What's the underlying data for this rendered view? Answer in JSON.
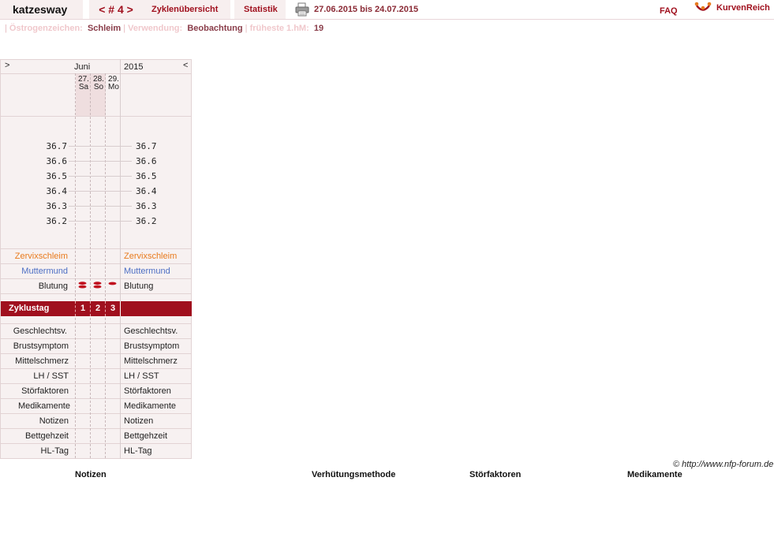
{
  "header": {
    "user": "katzesway",
    "cycle_nav": "< # 4 >",
    "tab_overview": "Zyklenübersicht",
    "tab_stats": "Statistik",
    "date_range": "27.06.2015 bis 24.07.2015",
    "faq": "FAQ",
    "brand": "KurvenReich"
  },
  "info": {
    "sep": "|",
    "estrogen_label": "Östrogenzeichen:",
    "estrogen_value": "Schleim",
    "use_label": "Verwendung:",
    "use_value": "Beobachtung",
    "earliest_label": "früheste 1.hM:",
    "earliest_value": "19"
  },
  "chart": {
    "nav_prev": ">",
    "nav_next": "<",
    "month": "Juni",
    "year": "2015",
    "days": [
      {
        "date": "27.",
        "weekday": "Sa"
      },
      {
        "date": "28.",
        "weekday": "So"
      },
      {
        "date": "29.",
        "weekday": "Mo"
      }
    ],
    "temperatures": [
      "36.7",
      "36.6",
      "36.5",
      "36.4",
      "36.3",
      "36.2"
    ],
    "rows_top": {
      "cervix": "Zervixschleim",
      "muttermund": "Muttermund",
      "blutung": "Blutung"
    },
    "bleeding": [
      2,
      2,
      1
    ],
    "zyklustag_label": "Zyklustag",
    "cycle_days": [
      "1",
      "2",
      "3"
    ],
    "rows_bottom": [
      "Geschlechtsv.",
      "Brustsymptom",
      "Mittelschmerz",
      "LH / SST",
      "Störfaktoren",
      "Medikamente",
      "Notizen",
      "Bettgehzeit",
      "HL-Tag"
    ]
  },
  "footer": {
    "copyright": "© http://www.nfp-forum.de",
    "legend": [
      "Notizen",
      "Verhütungsmethode",
      "Störfaktoren",
      "Medikamente"
    ]
  },
  "colors": {
    "accent": "#a0101e",
    "cervix": "#e87b1e",
    "muttermund": "#4d6fc4"
  }
}
